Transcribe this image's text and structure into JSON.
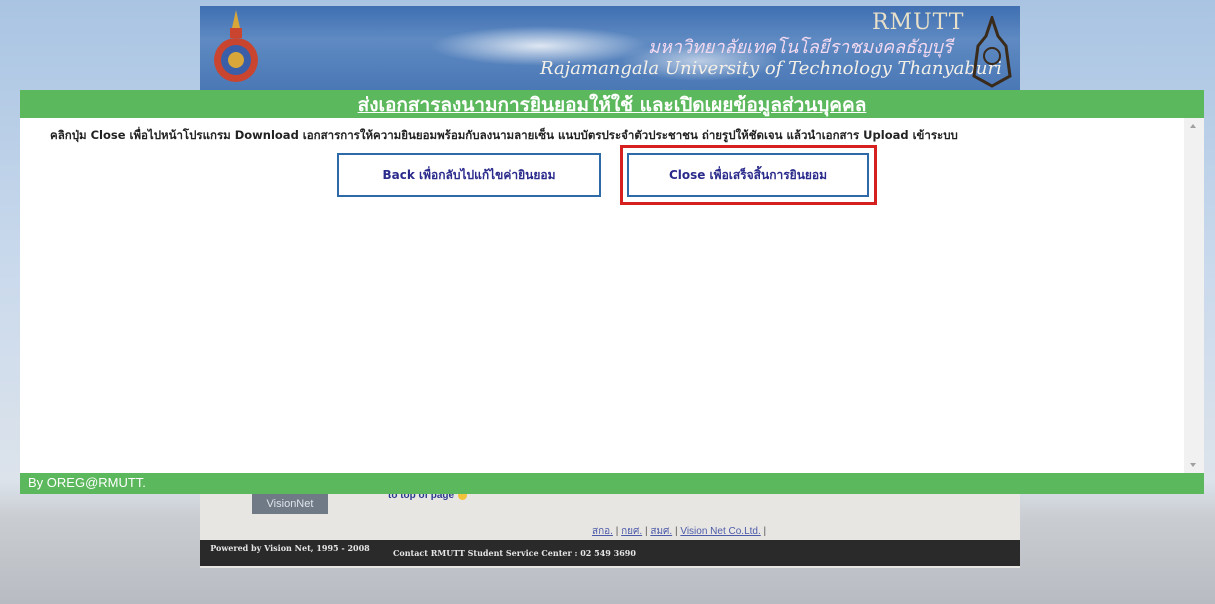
{
  "header": {
    "brand": "RMUTT",
    "thai_name": "มหาวิทยาลัยเทคโนโลยีราชมงคลธัญบุรี",
    "english_name": "Rajamangala University of Technology Thanyaburi"
  },
  "modal": {
    "title": "ส่งเอกสารลงนามการยินยอมให้ใช้ และเปิดเผยข้อมูลส่วนบุคคล",
    "instruction": "คลิกปุ่ม Close เพื่อไปหน้าโปรแกรม Download เอกสารการให้ความยินยอมพร้อมกับลงนามลายเซ็น แนบบัตรประจำตัวประชาชน ถ่ายรูปให้ชัดเจน แล้วนำเอกสาร Upload เข้าระบบ",
    "back_button": "Back เพื่อกลับไปแก้ไขค่ายินยอม",
    "close_button": "Close เพื่อเสร็จสิ้นการยินยอม",
    "footer_text": "By OREG@RMUTT."
  },
  "background_footer": {
    "visionnet_logo": "VisionNet",
    "to_top": "to top of page",
    "links": [
      "สกอ.",
      "กยศ.",
      "สมศ.",
      "Vision Net Co.Ltd."
    ],
    "powered_by": "Powered by Vision Net, 1995 - 2008",
    "contact": "Contact RMUTT Student Service Center : 02 549 3690"
  },
  "colors": {
    "green_bar": "#5cb85c",
    "button_border": "#2f6aa8",
    "highlight": "#d61f1f"
  }
}
